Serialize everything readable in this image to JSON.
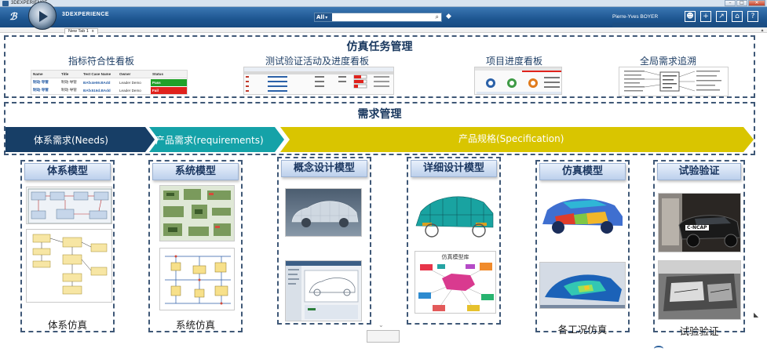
{
  "window": {
    "app_title": "3DEXPERIENCE"
  },
  "toolbar": {
    "brand": "3DEXPERIENCE",
    "search_scope": "All",
    "search_placeholder": "",
    "user": "Pierre-Yves BOYER",
    "icons": [
      "user-icon",
      "plus-icon",
      "share-icon",
      "home-icon",
      "help-icon"
    ]
  },
  "tabs": [
    {
      "label": "New Tab 1"
    }
  ],
  "simulation": {
    "title": "仿真任务管理",
    "dashboards": [
      {
        "label": "指标符合性看板"
      },
      {
        "label": "测试验证活动及进度看板"
      },
      {
        "label": "项目进度看板"
      },
      {
        "label": "全局需求追溯"
      }
    ],
    "table": {
      "headers": [
        "Name",
        "Title",
        "Test Case Name",
        "Owner",
        "Status"
      ],
      "rows": [
        {
          "name": "制动·导管",
          "title": "制动·导管",
          "case": "BAfx4e59.BAdd",
          "owner": "Leader Demo",
          "status": "Pass"
        },
        {
          "name": "制动·导管",
          "title": "制动·导管",
          "case": "BAfx516d.BAdd",
          "owner": "Leader Demo",
          "status": "Fail"
        }
      ]
    }
  },
  "requirements": {
    "title": "需求管理",
    "stages": [
      {
        "label": "体系需求(Needs)",
        "color": "#173e66"
      },
      {
        "label": "产品需求(requirements)",
        "color": "#15a2a8"
      },
      {
        "label": "产品规格(Specification)",
        "color": "#d9c500"
      }
    ]
  },
  "columns": [
    {
      "title": "体系模型",
      "footer": "体系仿真"
    },
    {
      "title": "系统模型",
      "footer": "系统仿真"
    },
    {
      "title": "概念设计模型",
      "footer": ""
    },
    {
      "title": "详细设计模型",
      "footer": ""
    },
    {
      "title": "仿真模型",
      "footer": "各工况仿真"
    },
    {
      "title": "试验验证",
      "footer": "试验验证"
    }
  ],
  "images": {
    "detail_design_caption": "仿真模型库",
    "crash_badge": "C-NCAP"
  }
}
